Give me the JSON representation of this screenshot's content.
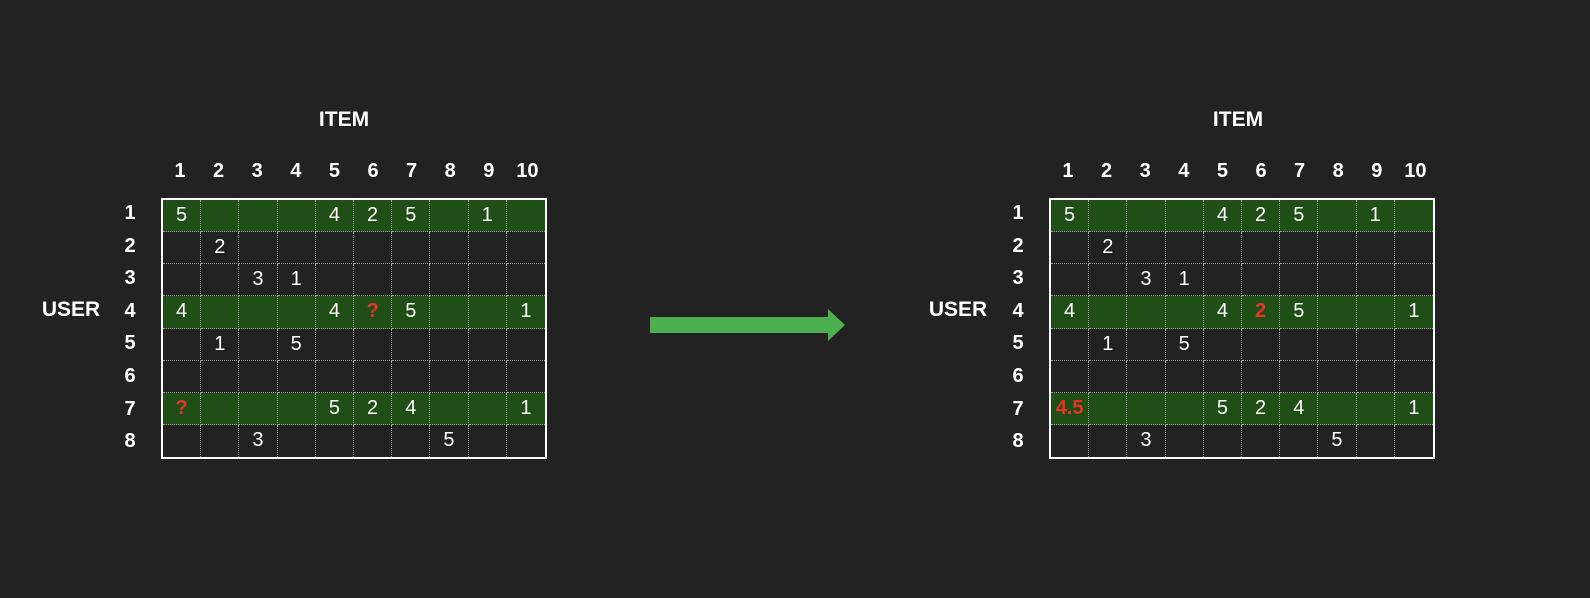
{
  "left": {
    "item_label": "ITEM",
    "user_label": "USER",
    "columns": [
      "1",
      "2",
      "3",
      "4",
      "5",
      "6",
      "7",
      "8",
      "9",
      "10"
    ],
    "rows": [
      {
        "label": "1",
        "highlight": true,
        "cells": [
          "5",
          "",
          "",
          "",
          "4",
          "2",
          "5",
          "",
          "1",
          ""
        ]
      },
      {
        "label": "2",
        "highlight": false,
        "cells": [
          "",
          "2",
          "",
          "",
          "",
          "",
          "",
          "",
          "",
          ""
        ]
      },
      {
        "label": "3",
        "highlight": false,
        "cells": [
          "",
          "",
          "3",
          "1",
          "",
          "",
          "",
          "",
          "",
          ""
        ]
      },
      {
        "label": "4",
        "highlight": true,
        "cells": [
          "4",
          "",
          "",
          "",
          "4",
          "?",
          "5",
          "",
          "",
          "1"
        ]
      },
      {
        "label": "5",
        "highlight": false,
        "cells": [
          "",
          "1",
          "",
          "5",
          "",
          "",
          "",
          "",
          "",
          ""
        ]
      },
      {
        "label": "6",
        "highlight": false,
        "cells": [
          "",
          "",
          "",
          "",
          "",
          "",
          "",
          "",
          "",
          ""
        ]
      },
      {
        "label": "7",
        "highlight": true,
        "cells": [
          "?",
          "",
          "",
          "",
          "5",
          "2",
          "4",
          "",
          "",
          "1"
        ]
      },
      {
        "label": "8",
        "highlight": false,
        "cells": [
          "",
          "",
          "3",
          "",
          "",
          "",
          "",
          "5",
          "",
          ""
        ]
      }
    ],
    "red_cells": [
      [
        3,
        5
      ],
      [
        6,
        0
      ]
    ]
  },
  "right": {
    "item_label": "ITEM",
    "user_label": "USER",
    "columns": [
      "1",
      "2",
      "3",
      "4",
      "5",
      "6",
      "7",
      "8",
      "9",
      "10"
    ],
    "rows": [
      {
        "label": "1",
        "highlight": true,
        "cells": [
          "5",
          "",
          "",
          "",
          "4",
          "2",
          "5",
          "",
          "1",
          ""
        ]
      },
      {
        "label": "2",
        "highlight": false,
        "cells": [
          "",
          "2",
          "",
          "",
          "",
          "",
          "",
          "",
          "",
          ""
        ]
      },
      {
        "label": "3",
        "highlight": false,
        "cells": [
          "",
          "",
          "3",
          "1",
          "",
          "",
          "",
          "",
          "",
          ""
        ]
      },
      {
        "label": "4",
        "highlight": true,
        "cells": [
          "4",
          "",
          "",
          "",
          "4",
          "2",
          "5",
          "",
          "",
          "1"
        ]
      },
      {
        "label": "5",
        "highlight": false,
        "cells": [
          "",
          "1",
          "",
          "5",
          "",
          "",
          "",
          "",
          "",
          ""
        ]
      },
      {
        "label": "6",
        "highlight": false,
        "cells": [
          "",
          "",
          "",
          "",
          "",
          "",
          "",
          "",
          "",
          ""
        ]
      },
      {
        "label": "7",
        "highlight": true,
        "cells": [
          "4.5",
          "",
          "",
          "",
          "5",
          "2",
          "4",
          "",
          "",
          "1"
        ]
      },
      {
        "label": "8",
        "highlight": false,
        "cells": [
          "",
          "",
          "3",
          "",
          "",
          "",
          "",
          "5",
          "",
          ""
        ]
      }
    ],
    "red_cells": [
      [
        3,
        5
      ],
      [
        6,
        0
      ]
    ]
  },
  "colors": {
    "background": "#222222",
    "highlight_row": "#1f4e16",
    "predicted_value": "#e8322a",
    "arrow": "#4caf50"
  },
  "arrow_icon": "right-arrow-icon"
}
